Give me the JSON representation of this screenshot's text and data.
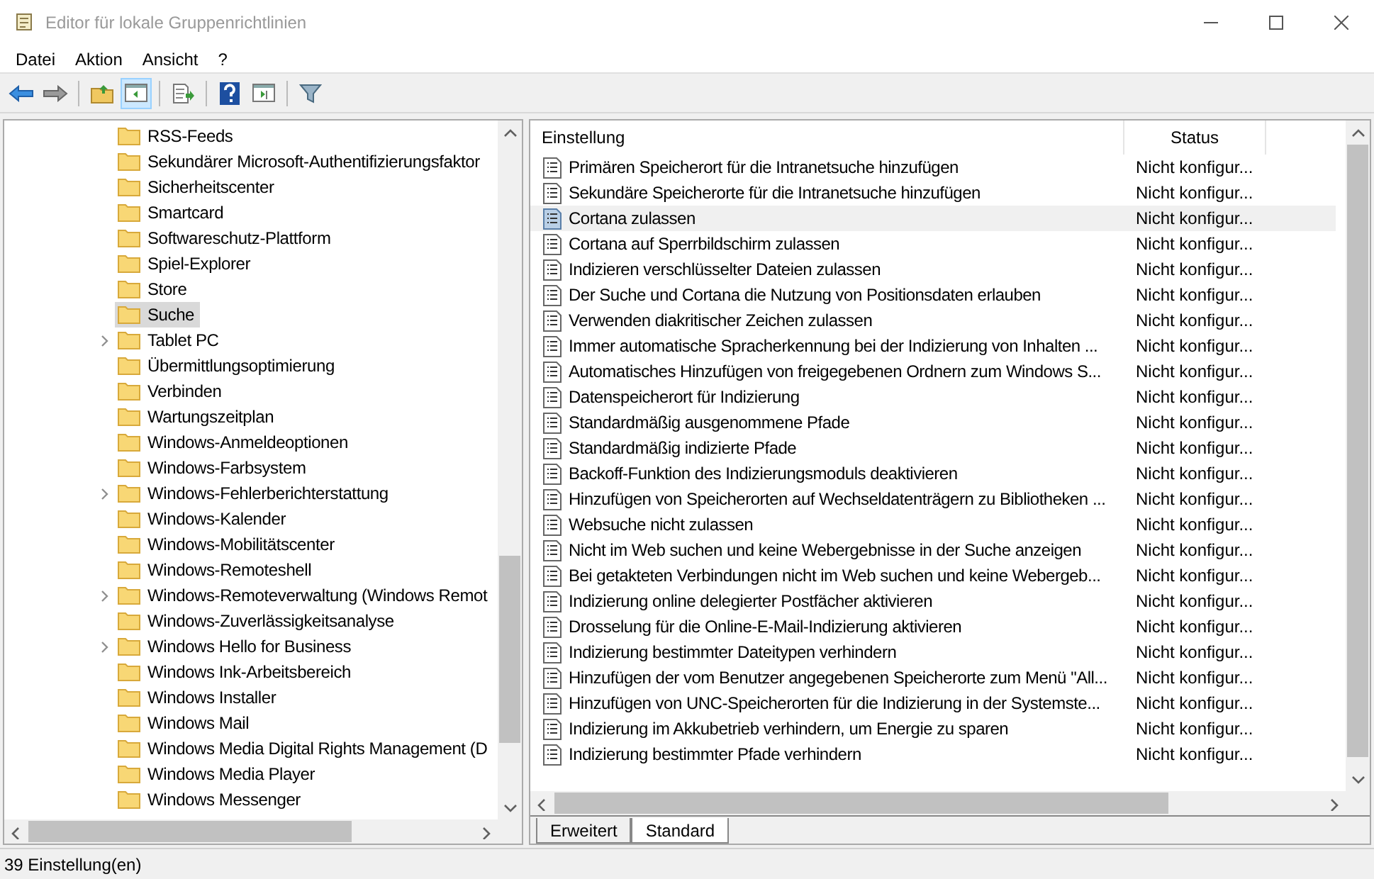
{
  "window": {
    "title": "Editor für lokale Gruppenrichtlinien"
  },
  "menu": [
    "Datei",
    "Aktion",
    "Ansicht",
    "?"
  ],
  "tree": [
    {
      "label": "RSS-Feeds",
      "has_children": false,
      "selected": false
    },
    {
      "label": "Sekundärer Microsoft-Authentifizierungsfaktor",
      "has_children": false,
      "selected": false
    },
    {
      "label": "Sicherheitscenter",
      "has_children": false,
      "selected": false
    },
    {
      "label": "Smartcard",
      "has_children": false,
      "selected": false
    },
    {
      "label": "Softwareschutz-Plattform",
      "has_children": false,
      "selected": false
    },
    {
      "label": "Spiel-Explorer",
      "has_children": false,
      "selected": false
    },
    {
      "label": "Store",
      "has_children": false,
      "selected": false
    },
    {
      "label": "Suche",
      "has_children": false,
      "selected": true
    },
    {
      "label": "Tablet PC",
      "has_children": true,
      "selected": false
    },
    {
      "label": "Übermittlungsoptimierung",
      "has_children": false,
      "selected": false
    },
    {
      "label": "Verbinden",
      "has_children": false,
      "selected": false
    },
    {
      "label": "Wartungszeitplan",
      "has_children": false,
      "selected": false
    },
    {
      "label": "Windows-Anmeldeoptionen",
      "has_children": false,
      "selected": false
    },
    {
      "label": "Windows-Farbsystem",
      "has_children": false,
      "selected": false
    },
    {
      "label": "Windows-Fehlerberichterstattung",
      "has_children": true,
      "selected": false
    },
    {
      "label": "Windows-Kalender",
      "has_children": false,
      "selected": false
    },
    {
      "label": "Windows-Mobilitätscenter",
      "has_children": false,
      "selected": false
    },
    {
      "label": "Windows-Remoteshell",
      "has_children": false,
      "selected": false
    },
    {
      "label": "Windows-Remoteverwaltung (Windows Remot",
      "has_children": true,
      "selected": false
    },
    {
      "label": "Windows-Zuverlässigkeitsanalyse",
      "has_children": false,
      "selected": false
    },
    {
      "label": "Windows Hello for Business",
      "has_children": true,
      "selected": false
    },
    {
      "label": "Windows Ink-Arbeitsbereich",
      "has_children": false,
      "selected": false
    },
    {
      "label": "Windows Installer",
      "has_children": false,
      "selected": false
    },
    {
      "label": "Windows Mail",
      "has_children": false,
      "selected": false
    },
    {
      "label": "Windows Media Digital Rights Management (D",
      "has_children": false,
      "selected": false
    },
    {
      "label": "Windows Media Player",
      "has_children": false,
      "selected": false
    },
    {
      "label": "Windows Messenger",
      "has_children": false,
      "selected": false
    }
  ],
  "table": {
    "columns": [
      "Einstellung",
      "Status"
    ],
    "rows": [
      {
        "setting": "Primären Speicherort für die Intranetsuche hinzufügen",
        "status": "Nicht konfigur...",
        "selected": false
      },
      {
        "setting": "Sekundäre Speicherorte für die Intranetsuche hinzufügen",
        "status": "Nicht konfigur...",
        "selected": false
      },
      {
        "setting": "Cortana zulassen",
        "status": "Nicht konfigur...",
        "selected": true
      },
      {
        "setting": "Cortana auf Sperrbildschirm zulassen",
        "status": "Nicht konfigur...",
        "selected": false
      },
      {
        "setting": "Indizieren verschlüsselter Dateien zulassen",
        "status": "Nicht konfigur...",
        "selected": false
      },
      {
        "setting": "Der Suche und Cortana die Nutzung von Positionsdaten erlauben",
        "status": "Nicht konfigur...",
        "selected": false
      },
      {
        "setting": "Verwenden diakritischer Zeichen zulassen",
        "status": "Nicht konfigur...",
        "selected": false
      },
      {
        "setting": "Immer automatische Spracherkennung bei der Indizierung von Inhalten ...",
        "status": "Nicht konfigur...",
        "selected": false
      },
      {
        "setting": "Automatisches Hinzufügen von freigegebenen Ordnern zum Windows S...",
        "status": "Nicht konfigur...",
        "selected": false
      },
      {
        "setting": "Datenspeicherort für Indizierung",
        "status": "Nicht konfigur...",
        "selected": false
      },
      {
        "setting": "Standardmäßig ausgenommene Pfade",
        "status": "Nicht konfigur...",
        "selected": false
      },
      {
        "setting": "Standardmäßig indizierte Pfade",
        "status": "Nicht konfigur...",
        "selected": false
      },
      {
        "setting": "Backoff-Funktion des Indizierungsmoduls deaktivieren",
        "status": "Nicht konfigur...",
        "selected": false
      },
      {
        "setting": "Hinzufügen von Speicherorten auf Wechseldatenträgern zu Bibliotheken ...",
        "status": "Nicht konfigur...",
        "selected": false
      },
      {
        "setting": "Websuche nicht zulassen",
        "status": "Nicht konfigur...",
        "selected": false
      },
      {
        "setting": "Nicht im Web suchen und keine Webergebnisse in der Suche anzeigen",
        "status": "Nicht konfigur...",
        "selected": false
      },
      {
        "setting": "Bei getakteten Verbindungen nicht im Web suchen und keine Webergeb...",
        "status": "Nicht konfigur...",
        "selected": false
      },
      {
        "setting": "Indizierung online delegierter Postfächer aktivieren",
        "status": "Nicht konfigur...",
        "selected": false
      },
      {
        "setting": "Drosselung für die Online-E-Mail-Indizierung aktivieren",
        "status": "Nicht konfigur...",
        "selected": false
      },
      {
        "setting": "Indizierung bestimmter Dateitypen verhindern",
        "status": "Nicht konfigur...",
        "selected": false
      },
      {
        "setting": "Hinzufügen der vom Benutzer angegebenen Speicherorte zum Menü \"All...",
        "status": "Nicht konfigur...",
        "selected": false
      },
      {
        "setting": "Hinzufügen von UNC-Speicherorten für die Indizierung in der Systemste...",
        "status": "Nicht konfigur...",
        "selected": false
      },
      {
        "setting": "Indizierung im Akkubetrieb verhindern, um Energie zu sparen",
        "status": "Nicht konfigur...",
        "selected": false
      },
      {
        "setting": "Indizierung bestimmter Pfade verhindern",
        "status": "Nicht konfigur...",
        "selected": false
      }
    ]
  },
  "tabs": [
    {
      "label": "Erweitert",
      "selected": false
    },
    {
      "label": "Standard",
      "selected": true
    }
  ],
  "status_bar": "39 Einstellung(en)"
}
